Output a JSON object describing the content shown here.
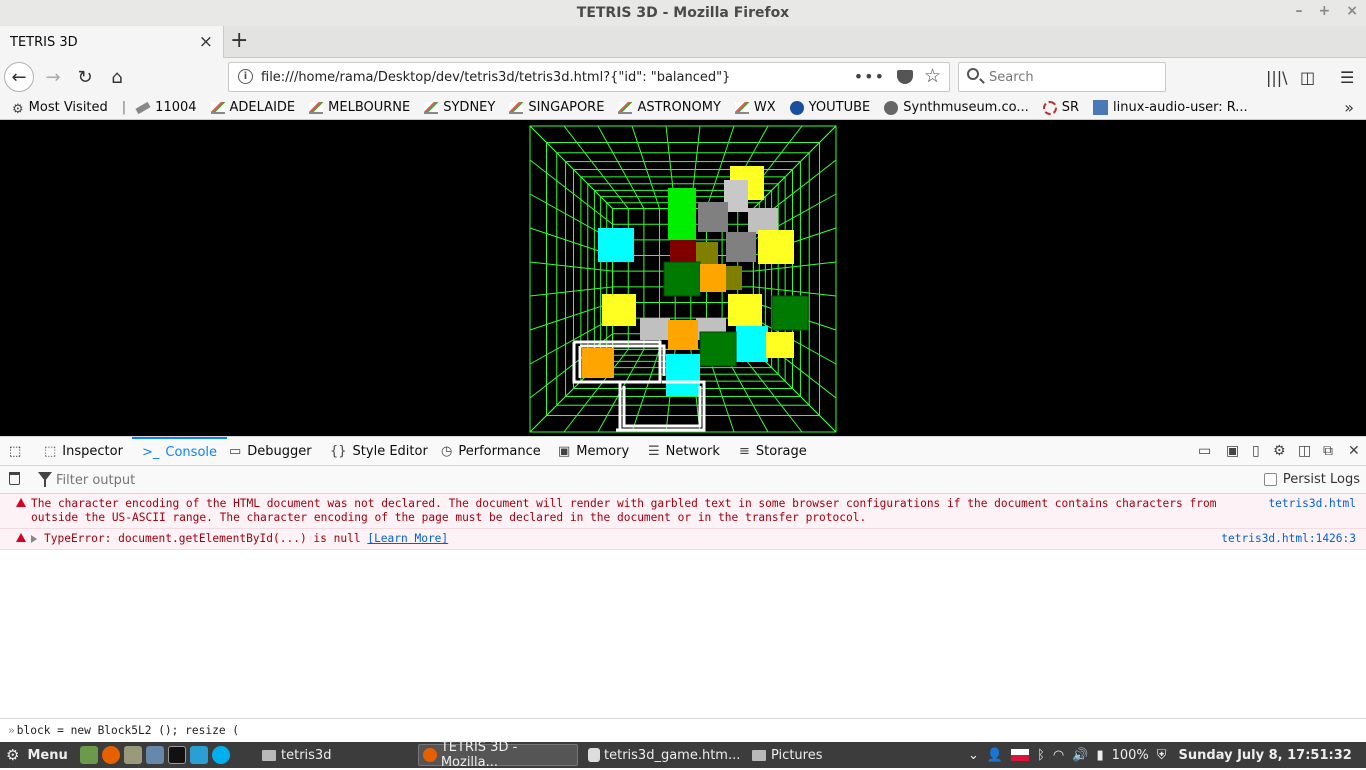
{
  "window": {
    "title": "TETRIS 3D - Mozilla Firefox",
    "controls": [
      "–",
      "+",
      "×"
    ]
  },
  "tab": {
    "label": "TETRIS 3D",
    "close": "×",
    "new_tab": "+"
  },
  "nav": {
    "back": "←",
    "forward": "→",
    "reload": "↻",
    "home": "⌂",
    "url": "file:///home/rama/Desktop/dev/tetris3d/tetris3d.html?{\"id\": \"balanced\"}",
    "page_actions": "•••",
    "bookmark_star": "☆",
    "search_placeholder": "Search",
    "library": "|||\\",
    "sidebar": "◫",
    "menu": "☰"
  },
  "bookmarks": {
    "items": [
      {
        "label": "Most Visited",
        "icon": "gear-icon"
      },
      {
        "label": "11004",
        "icon": "ticket-icon"
      },
      {
        "label": "ADELAIDE",
        "icon": "chart-icon"
      },
      {
        "label": "MELBOURNE",
        "icon": "chart-icon"
      },
      {
        "label": "SYDNEY",
        "icon": "chart-icon"
      },
      {
        "label": "SINGAPORE",
        "icon": "chart-icon"
      },
      {
        "label": "ASTRONOMY",
        "icon": "chart-icon"
      },
      {
        "label": "WX",
        "icon": "chart-icon"
      },
      {
        "label": "YOUTUBE",
        "icon": "youtube-icon"
      },
      {
        "label": "Synthmuseum.co...",
        "icon": "synth-icon"
      },
      {
        "label": "SR",
        "icon": "sr-icon"
      },
      {
        "label": "linux-audio-user: R...",
        "icon": "linux-audio-icon"
      }
    ],
    "separator": "|",
    "more": "»"
  },
  "devtools": {
    "tabs": [
      {
        "label": "Inspector",
        "glyph": "⬚"
      },
      {
        "label": "Console",
        "glyph": ">_"
      },
      {
        "label": "Debugger",
        "glyph": "▭"
      },
      {
        "label": "Style Editor",
        "glyph": "{}"
      },
      {
        "label": "Performance",
        "glyph": "◷"
      },
      {
        "label": "Memory",
        "glyph": "▣"
      },
      {
        "label": "Network",
        "glyph": "☰"
      },
      {
        "label": "Storage",
        "glyph": "≡"
      }
    ],
    "filter_placeholder": "Filter output",
    "persist_logs": "Persist Logs",
    "messages": [
      {
        "text": "The character encoding of the HTML document was not declared. The document will render with garbled text in some browser configurations if the document contains characters from outside the US-ASCII range. The character encoding of the page must be declared in the document or in the transfer protocol.",
        "source": "tetris3d.html"
      },
      {
        "text": "TypeError: document.getElementById(...) is null",
        "link": "[Learn More]",
        "source": "tetris3d.html:1426:3"
      }
    ],
    "input_prompt": "»",
    "input_value": "block = new Block5L2 (); resize ("
  },
  "taskbar": {
    "menu": "Menu",
    "windows": [
      {
        "label": "tetris3d",
        "icon": "folder-icon"
      },
      {
        "label": "TETRIS 3D - Mozilla...",
        "icon": "firefox-icon"
      },
      {
        "label": "tetris3d_game.htm...",
        "icon": "text-editor-icon"
      },
      {
        "label": "Pictures",
        "icon": "folder-icon"
      }
    ],
    "battery": "100%",
    "clock": "Sunday July  8, 17:51:32"
  },
  "colors": {
    "grid": "#33ff33",
    "accent": "#0a84ff",
    "error": "#a4000f",
    "error_bg": "#fdf2f5"
  }
}
